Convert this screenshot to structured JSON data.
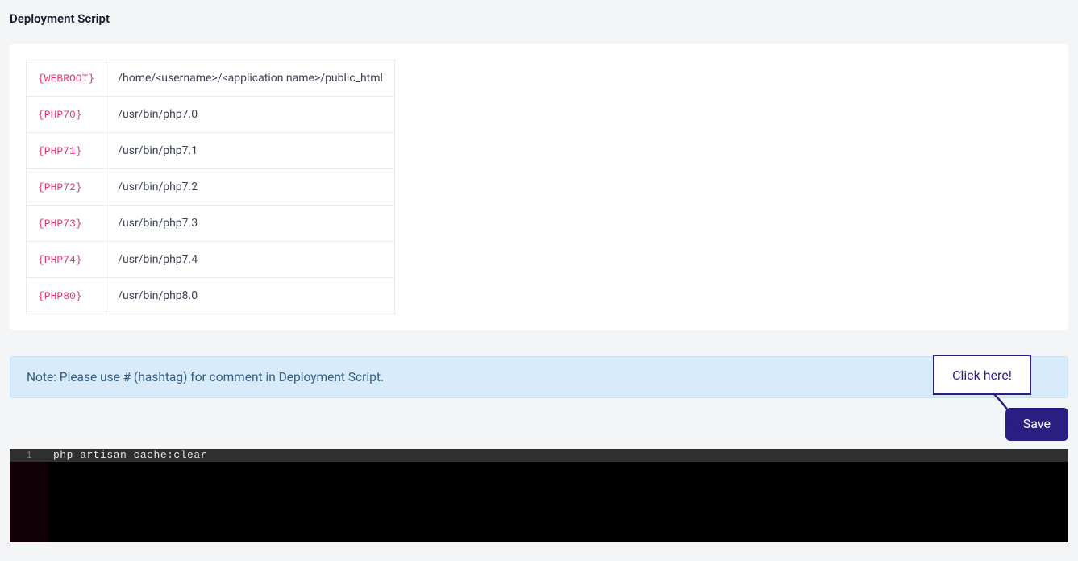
{
  "title": "Deployment Script",
  "variables": [
    {
      "key": "{WEBROOT}",
      "value": "/home/<username>/<application name>/public_html"
    },
    {
      "key": "{PHP70}",
      "value": "/usr/bin/php7.0"
    },
    {
      "key": "{PHP71}",
      "value": "/usr/bin/php7.1"
    },
    {
      "key": "{PHP72}",
      "value": "/usr/bin/php7.2"
    },
    {
      "key": "{PHP73}",
      "value": "/usr/bin/php7.3"
    },
    {
      "key": "{PHP74}",
      "value": "/usr/bin/php7.4"
    },
    {
      "key": "{PHP80}",
      "value": "/usr/bin/php8.0"
    }
  ],
  "note": "Note: Please use # (hashtag) for comment in Deployment Script.",
  "save_label": "Save",
  "callout_label": "Click here!",
  "editor": {
    "line_number": "1",
    "line1": "php artisan cache:clear"
  }
}
